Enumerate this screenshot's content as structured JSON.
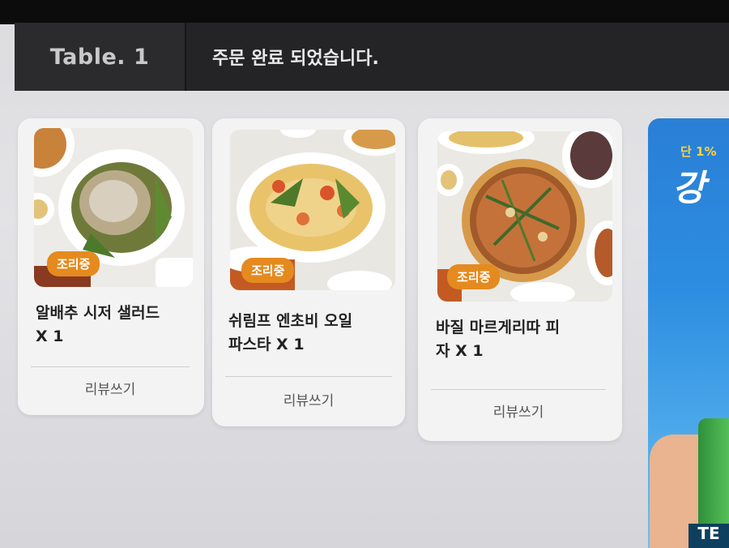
{
  "header": {
    "table_label": "Table. 1",
    "order_status": "주문 완료 되었습니다."
  },
  "orders": [
    {
      "status": "조리중",
      "name_line1": "알배추 시저 샐러드",
      "name_line2": "X 1",
      "review_label": "리뷰쓰기",
      "photo_icon": "caesar-salad-photo"
    },
    {
      "status": "조리중",
      "name_line1": "쉬림프 엔초비 오일",
      "name_line2": "파스타 X 1",
      "review_label": "리뷰쓰기",
      "photo_icon": "shrimp-pasta-photo"
    },
    {
      "status": "조리중",
      "name_line1": "바질 마르게리따 피",
      "name_line2": "자 X 1",
      "review_label": "리뷰쓰기",
      "photo_icon": "margherita-pizza-photo"
    }
  ],
  "ad": {
    "tagline": "단 1%",
    "headline": "강",
    "bottle_label": "TE"
  },
  "colors": {
    "header_bg": "#242426",
    "badge": "#e58a1f",
    "card_bg": "#f3f3f4"
  }
}
